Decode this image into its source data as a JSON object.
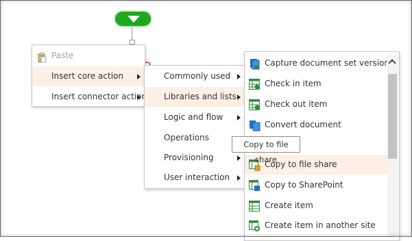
{
  "context_menu": {
    "paste_label": "Paste",
    "insert_core_action": "Insert core action",
    "insert_connector_action": "Insert connector action"
  },
  "core_submenu": {
    "items": [
      "Commonly used",
      "Libraries and lists",
      "Logic and flow",
      "Operations",
      "Provisioning",
      "User interaction"
    ]
  },
  "actions_list": {
    "items": [
      {
        "label": "Capture document set version",
        "icon": "document-set-icon"
      },
      {
        "label": "Check in item",
        "icon": "list-item-icon"
      },
      {
        "label": "Check out item",
        "icon": "list-item-icon"
      },
      {
        "label": "Convert document",
        "icon": "document-convert-icon"
      },
      {
        "label": "Copy to file share",
        "icon": "list-copy-icon"
      },
      {
        "label": "Copy to SharePoint",
        "icon": "list-copy-icon"
      },
      {
        "label": "Create item",
        "icon": "list-item-icon"
      },
      {
        "label": "Create item in another site",
        "icon": "list-add-icon"
      }
    ]
  },
  "tooltip": {
    "text": "Copy to file share"
  },
  "colors": {
    "start_green": "#1fa81f",
    "highlight": "#fcefe6",
    "icon_blue": "#1f73c9",
    "icon_green": "#2f8a3a"
  }
}
